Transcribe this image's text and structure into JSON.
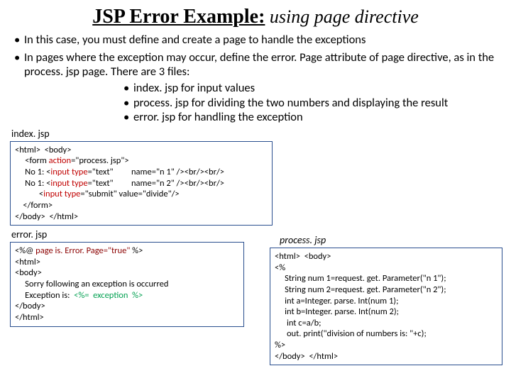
{
  "title": {
    "main": "JSP Error Example:",
    "sub": " using  page directive"
  },
  "bullets": {
    "b1": "In this case, you must define and create a page to handle the exceptions",
    "b2": "In pages where the exception may occur, define the error. Page attribute of page directive, as in the process. jsp page. There are 3 files:",
    "s1": "index. jsp for input values",
    "s2": "process. jsp for dividing the two numbers and displaying the result",
    "s3": "error. jsp for handling the exception"
  },
  "labels": {
    "index": "index. jsp",
    "error": "error. jsp",
    "process": "process. jsp"
  },
  "code": {
    "index": {
      "l1": "<html>  <body>",
      "l2a": "     <form ",
      "l2b": "action",
      "l2c": "=\"process. jsp\">",
      "l3a": "     No 1: <",
      "l3b": "input type",
      "l3c": "=\"text\"         name=\"n 1\" /><br/><br/>",
      "l4a": "     No 1: <",
      "l4b": "input type",
      "l4c": "=\"text\"         name=\"n 2\" /><br/><br/>",
      "l5a": "            <",
      "l5b": "input type",
      "l5c": "=\"submit\" value=\"divide\"/>",
      "l6": "    </form>",
      "l7": "</body>  </html>"
    },
    "error": {
      "l1a": "<%@ ",
      "l1b": "page is. Error. Page=\"true\" ",
      "l1c": "%>",
      "l2": "<html>",
      "l3": "<body>",
      "l4": "     Sorry following an exception is occurred",
      "l5a": "     Exception is:  ",
      "l5b": "<%=  exception  %>",
      "l6": "</body>",
      "l7": "</html>"
    },
    "process": {
      "l1": "<html>  <body>",
      "l2": "<%",
      "l3": "     String num 1=request. get. Parameter(\"n 1\");",
      "l4": "     String num 2=request. get. Parameter(\"n 2\");",
      "l5": "     int a=Integer. parse. Int(num 1);",
      "l6": "     int b=Integer. parse. Int(num 2);",
      "l7": "      int c=a/b;",
      "l8": "      out. print(\"division of numbers is: \"+c);",
      "l9": "%>",
      "l10": "</body>  </html>"
    }
  }
}
